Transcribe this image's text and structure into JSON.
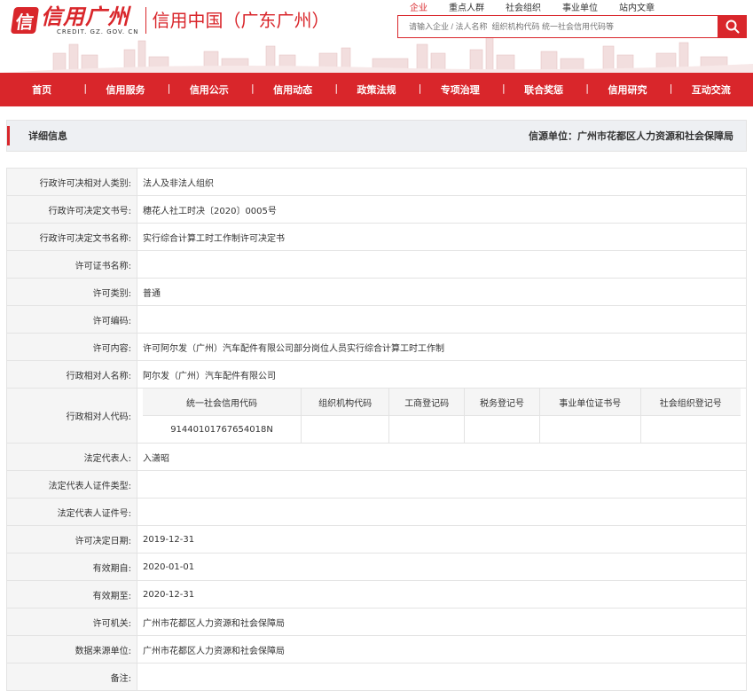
{
  "brand": {
    "logo_char": "信",
    "name": "信用广州",
    "domain": "CREDIT. GZ. GOV. CN",
    "subtitle": "信用中国（广东广州）"
  },
  "search": {
    "tabs": [
      "企业",
      "重点人群",
      "社会组织",
      "事业单位",
      "站内文章"
    ],
    "placeholder": "请输入企业 / 法人名称  组织机构代码 统一社会信用代码等"
  },
  "nav": [
    "首页",
    "信用服务",
    "信用公示",
    "信用动态",
    "政策法规",
    "专项治理",
    "联合奖惩",
    "信用研究",
    "互动交流"
  ],
  "detail": {
    "title": "详细信息",
    "source": "信源单位：广州市花都区人力资源和社会保障局"
  },
  "fields": {
    "f1": {
      "label": "行政许可决相对人类别:",
      "value": "法人及非法人组织"
    },
    "f2": {
      "label": "行政许可决定文书号:",
      "value": "穗花人社工时决〔2020〕0005号"
    },
    "f3": {
      "label": "行政许可决定文书名称:",
      "value": "实行综合计算工时工作制许可决定书"
    },
    "f4": {
      "label": "许可证书名称:",
      "value": ""
    },
    "f5": {
      "label": "许可类别:",
      "value": "普通"
    },
    "f6": {
      "label": "许可编码:",
      "value": ""
    },
    "f7": {
      "label": "许可内容:",
      "value": "许可阿尔发（广州）汽车配件有限公司部分岗位人员实行综合计算工时工作制"
    },
    "f8": {
      "label": "行政相对人名称:",
      "value": "阿尔发（广州）汽车配件有限公司"
    },
    "f9": {
      "label": "行政相对人代码:"
    },
    "f10": {
      "label": "法定代表人:",
      "value": "入潇昭"
    },
    "f11": {
      "label": "法定代表人证件类型:",
      "value": ""
    },
    "f12": {
      "label": "法定代表人证件号:",
      "value": ""
    },
    "f13": {
      "label": "许可决定日期:",
      "value": "2019-12-31"
    },
    "f14": {
      "label": "有效期自:",
      "value": "2020-01-01"
    },
    "f15": {
      "label": "有效期至:",
      "value": "2020-12-31"
    },
    "f16": {
      "label": "许可机关:",
      "value": "广州市花都区人力资源和社会保障局"
    },
    "f17": {
      "label": "数据来源单位:",
      "value": "广州市花都区人力资源和社会保障局"
    },
    "f18": {
      "label": "备注:",
      "value": ""
    }
  },
  "codes": {
    "headers": [
      "统一社会信用代码",
      "组织机构代码",
      "工商登记码",
      "税务登记号",
      "事业单位证书号",
      "社会组织登记号"
    ],
    "values": [
      "91440101767654018N",
      "",
      "",
      "",
      "",
      ""
    ]
  },
  "colors": {
    "brand_red": "#d9262b",
    "label_bg": "#f5f5f5",
    "border": "#e3e3e3"
  }
}
